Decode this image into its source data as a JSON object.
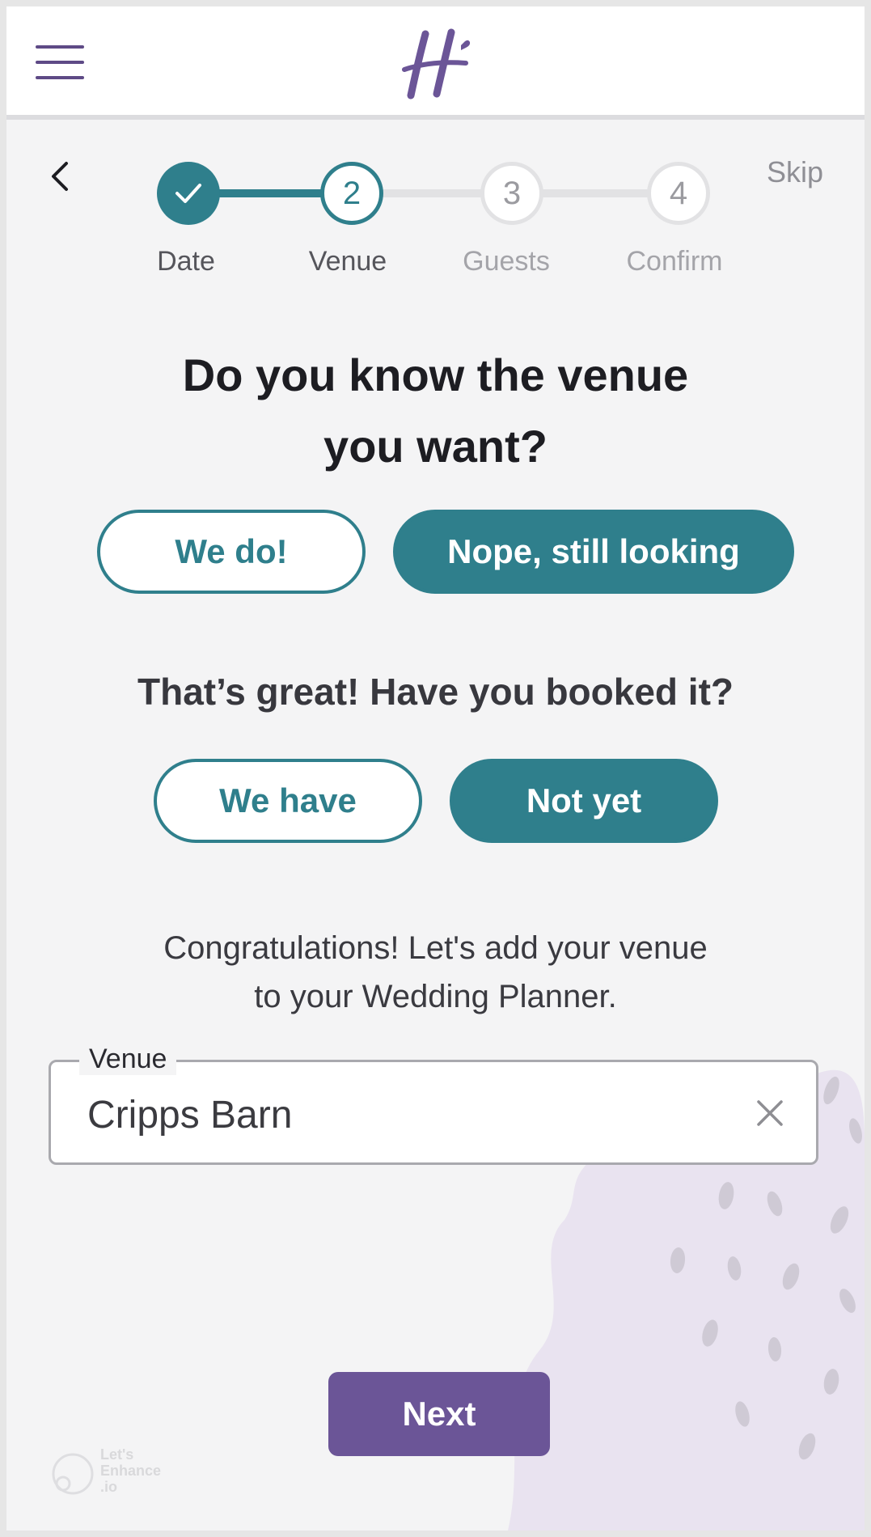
{
  "header": {
    "menu_icon": "hamburger-menu-icon",
    "logo_icon": "h-brand-logo-icon",
    "brand_color": "#6b5597"
  },
  "stepper": {
    "back_icon": "chevron-left-icon",
    "skip_label": "Skip",
    "steps": [
      {
        "number": "",
        "label": "Date",
        "state": "completed"
      },
      {
        "number": "2",
        "label": "Venue",
        "state": "current"
      },
      {
        "number": "3",
        "label": "Guests",
        "state": "upcoming"
      },
      {
        "number": "4",
        "label": "Confirm",
        "state": "upcoming"
      }
    ],
    "accent_color": "#2f7f8c"
  },
  "question": {
    "line1": "Do you know the venue",
    "line2": "you want?",
    "option_yes": "We do!",
    "option_no": "Nope, still looking"
  },
  "booked": {
    "question": "That’s great! Have you booked it?",
    "option_yes": "We have",
    "option_no": "Not yet"
  },
  "congrats": {
    "line1": "Congratulations! Let's add your venue",
    "line2": "to your Wedding Planner."
  },
  "venue_field": {
    "label": "Venue",
    "value": "Cripps Barn",
    "clear_icon": "close-icon"
  },
  "next_label": "Next",
  "watermark": {
    "line1": "Let's",
    "line2": "Enhance",
    "line3": ".io"
  }
}
